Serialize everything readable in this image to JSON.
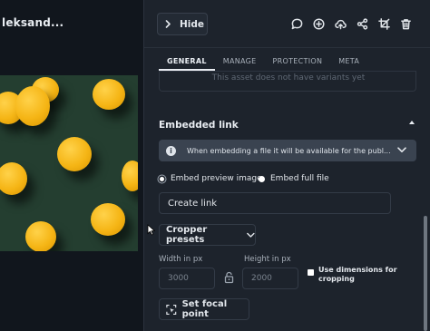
{
  "asset": {
    "title": "leksand..."
  },
  "toolbar": {
    "hide_label": "Hide",
    "icons": [
      "comment-icon",
      "add-icon",
      "cloud-upload-icon",
      "share-icon",
      "crop-icon",
      "trash-icon"
    ]
  },
  "tabs": [
    {
      "label": "GENERAL",
      "active": true
    },
    {
      "label": "MANAGE",
      "active": false
    },
    {
      "label": "PROTECTION",
      "active": false
    },
    {
      "label": "META",
      "active": false
    }
  ],
  "variants": {
    "empty_text": "This asset does not have variants yet"
  },
  "embedded_link": {
    "title": "Embedded link",
    "info_text": "When embedding a file it will be available for the publ...",
    "options": [
      {
        "label": "Embed preview image",
        "selected": true
      },
      {
        "label": "Embed full file",
        "selected": false
      }
    ],
    "create_link_label": "Create link"
  },
  "cropper": {
    "presets_label": "Cropper presets",
    "width_label": "Width in px",
    "height_label": "Height in px",
    "width_value": "3000",
    "height_value": "2000",
    "use_dimensions_label": "Use dimensions for cropping",
    "use_dimensions_checked": false,
    "focal_point_label": "Set focal point"
  },
  "colors": {
    "panel_bg": "#1d232c",
    "preview_bg": "#11161d",
    "info_bar_bg": "#3a4350",
    "photo_bg": "#243e30",
    "lemon": "#f5b515"
  }
}
